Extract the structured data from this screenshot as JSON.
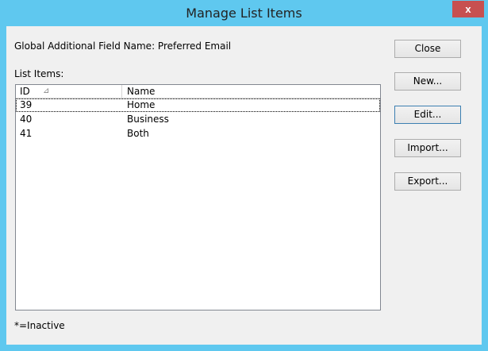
{
  "window": {
    "title": "Manage List Items",
    "close_glyph": "x"
  },
  "field": {
    "label_text": "Global Additional Field Name: Preferred Email"
  },
  "list": {
    "caption": "List Items:",
    "columns": [
      "ID",
      "Name"
    ],
    "sort_indicator": "⊿",
    "rows": [
      {
        "id": "39",
        "name": "Home"
      },
      {
        "id": "40",
        "name": "Business"
      },
      {
        "id": "41",
        "name": "Both"
      }
    ]
  },
  "buttons": {
    "close": "Close",
    "new": "New...",
    "edit": "Edit...",
    "import": "Import...",
    "export": "Export..."
  },
  "footer": {
    "note": "*=Inactive"
  },
  "colors": {
    "titlebar": "#5fc8ef",
    "close_button": "#c75050"
  }
}
